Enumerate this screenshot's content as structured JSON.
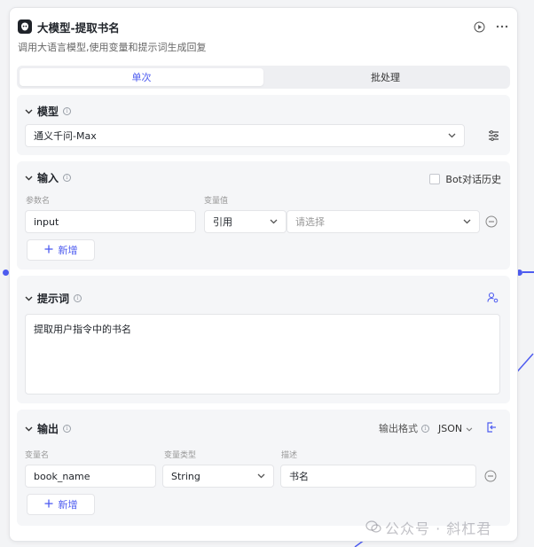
{
  "node": {
    "title": "大模型-提取书名",
    "description": "调用大语言模型,使用变量和提示词生成回复"
  },
  "tabs": [
    {
      "label": "单次",
      "active": true
    },
    {
      "label": "批处理",
      "active": false
    }
  ],
  "model": {
    "heading": "模型",
    "selected": "通义千问-Max"
  },
  "input": {
    "heading": "输入",
    "history_checkbox_label": "Bot对话历史",
    "col_name_label": "参数名",
    "col_value_label": "变量值",
    "row": {
      "name": "input",
      "type": "引用",
      "value_placeholder": "请选择"
    },
    "add_label": "新增"
  },
  "prompt": {
    "heading": "提示词",
    "text": "提取用户指令中的书名"
  },
  "output": {
    "heading": "输出",
    "format_label": "输出格式",
    "format_value": "JSON",
    "col_name_label": "变量名",
    "col_type_label": "变量类型",
    "col_desc_label": "描述",
    "row": {
      "name": "book_name",
      "type": "String",
      "desc": "书名"
    },
    "add_label": "新增"
  },
  "watermark": "公众号 · 斜杠君",
  "colors": {
    "accent": "#4e5cf0",
    "section_bg": "#f5f6f8",
    "border": "#e4e5e8"
  }
}
